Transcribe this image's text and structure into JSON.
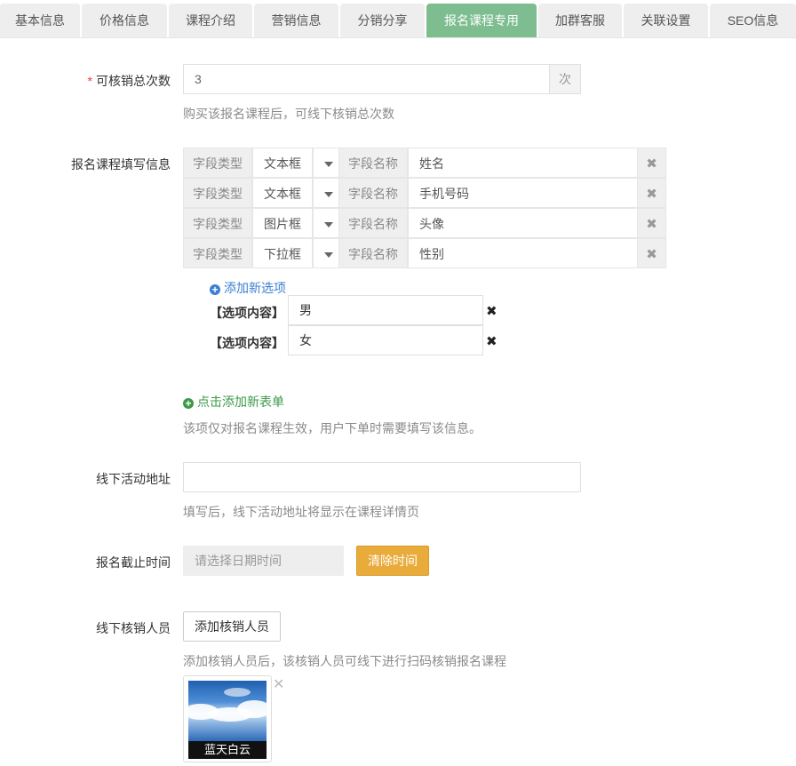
{
  "tabs": [
    {
      "label": "基本信息",
      "active": false
    },
    {
      "label": "价格信息",
      "active": false
    },
    {
      "label": "课程介绍",
      "active": false
    },
    {
      "label": "营销信息",
      "active": false
    },
    {
      "label": "分销分享",
      "active": false
    },
    {
      "label": "报名课程专用",
      "active": true
    },
    {
      "label": "加群客服",
      "active": false
    },
    {
      "label": "关联设置",
      "active": false
    },
    {
      "label": "SEO信息",
      "active": false
    }
  ],
  "verify_count": {
    "label": "可核销总次数",
    "value": "3",
    "unit": "次",
    "hint": "购买该报名课程后，可线下核销总次数"
  },
  "form_info": {
    "label": "报名课程填写信息",
    "type_label": "字段类型",
    "name_label": "字段名称",
    "fields": [
      {
        "type": "文本框",
        "name": "姓名"
      },
      {
        "type": "文本框",
        "name": "手机号码"
      },
      {
        "type": "图片框",
        "name": "头像"
      },
      {
        "type": "下拉框",
        "name": "性别"
      }
    ],
    "add_option": "添加新选项",
    "option_label": "【选项内容】",
    "options": [
      "男",
      "女"
    ],
    "add_form": "点击添加新表单",
    "hint": "该项仅对报名课程生效，用户下单时需要填写该信息。"
  },
  "address": {
    "label": "线下活动地址",
    "value": "",
    "hint": "填写后，线下活动地址将显示在课程详情页"
  },
  "deadline": {
    "label": "报名截止时间",
    "placeholder": "请选择日期时间",
    "clear_button": "清除时间"
  },
  "verifier": {
    "label": "线下核销人员",
    "add_button": "添加核销人员",
    "hint": "添加核销人员后，该核销人员可线下进行扫码核销报名课程",
    "people": [
      {
        "name": "蓝天白云"
      }
    ]
  },
  "colors": {
    "active_tab": "#7dbd8f",
    "clear_button": "#e9ab3a",
    "link_blue": "#3a7fd5",
    "link_green": "#3c9a47",
    "required": "#e4393c"
  }
}
